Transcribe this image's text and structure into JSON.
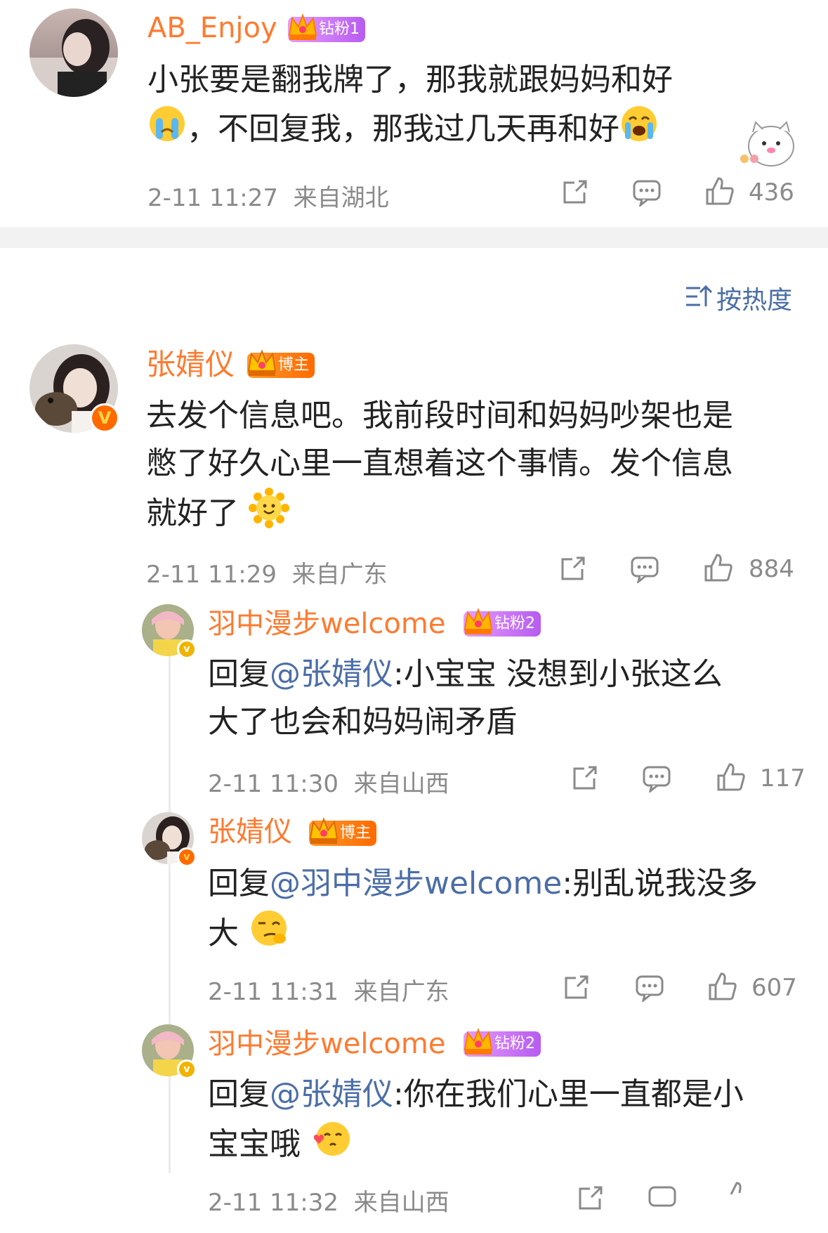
{
  "comment_top": {
    "username": "AB_Enjoy",
    "badge": "钻粉1",
    "text_line1": "小张要是翻我牌了，那我就跟妈妈和好",
    "text_line2_after_emoji": "，不回复我，那我过几天再和好",
    "time": "2-11 11:27",
    "location": "来自湖北",
    "likes": "436"
  },
  "sort_label": "按热度",
  "comment_main": {
    "username": "张婧仪",
    "badge": "博主",
    "text_line1": "去发个信息吧。我前段时间和妈妈吵架也是",
    "text_line2": "憋了好久心里一直想着这个事情。发个信息",
    "text_line3": "就好了",
    "time": "2-11 11:29",
    "location": "来自广东",
    "likes": "884"
  },
  "replies": [
    {
      "username": "羽中漫步welcome",
      "badge": "钻粉2",
      "reply_prefix": "回复",
      "mention": "@张婧仪",
      "text_line1": ":小宝宝 没想到小张这么",
      "text_line2": "大了也会和妈妈闹矛盾",
      "time": "2-11 11:30",
      "location": "来自山西",
      "likes": "117"
    },
    {
      "username": "张婧仪",
      "badge": "博主",
      "reply_prefix": "回复",
      "mention": "@羽中漫步welcome",
      "text_line1": ":别乱说我没多",
      "text_line2": "大",
      "time": "2-11 11:31",
      "location": "来自广东",
      "likes": "607"
    },
    {
      "username": "羽中漫步welcome",
      "badge": "钻粉2",
      "reply_prefix": "回复",
      "mention": "@张婧仪",
      "text_line1": ":你在我们心里一直都是小",
      "text_line2": "宝宝哦",
      "time": "2-11 11:32",
      "location": "来自山西",
      "likes": ""
    }
  ],
  "colors": {
    "username": "#ff7a2f",
    "mention": "#4b6ea7",
    "meta": "#8a8a8a",
    "divider": "#f2f2f2"
  },
  "icons": [
    "share-icon",
    "comment-icon",
    "like-icon",
    "sort-icon",
    "crown-icon",
    "verified-icon"
  ]
}
